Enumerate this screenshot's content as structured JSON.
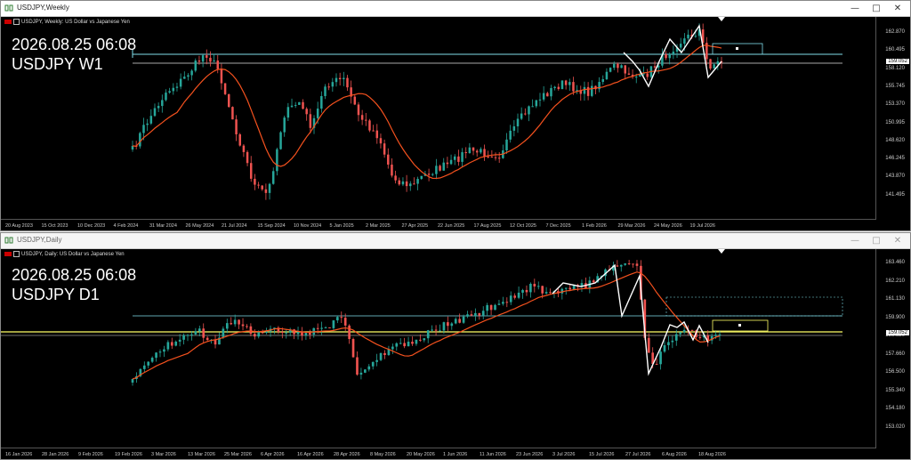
{
  "weekly": {
    "window_title": "USDJPY,Weekly",
    "symbol_desc": "USDJPY, Weekly:  US Dollar vs Japanese Yen",
    "datetime": "2026.08.25 06:08",
    "label": "USDJPY W1",
    "current_price": "159.052",
    "colors": {
      "bull": "#26a69a",
      "bear": "#ef5350",
      "ma": "#f4511e",
      "level": "#80deea"
    },
    "y_ticks": [
      "162.870",
      "160.495",
      "158.120",
      "155.745",
      "153.370",
      "150.995",
      "148.620",
      "146.245",
      "143.870",
      "141.495"
    ],
    "x_ticks": [
      "20 Aug 2023",
      "15 Oct 2023",
      "10 Dec 2023",
      "4 Feb 2024",
      "31 Mar 2024",
      "26 May 2024",
      "21 Jul 2024",
      "15 Sep 2024",
      "10 Nov 2024",
      "5 Jan 2025",
      "2 Mar 2025",
      "27 Apr 2025",
      "22 Jun 2025",
      "17 Aug 2025",
      "12 Oct 2025",
      "7 Dec 2025",
      "1 Feb 2026",
      "29 Mar 2026",
      "24 May 2026",
      "19 Jul 2026"
    ]
  },
  "daily": {
    "window_title": "USDJPY,Daily",
    "symbol_desc": "USDJPY, Daily:  US Dollar vs Japanese Yen",
    "datetime": "2026.08.25 06:08",
    "label": "USDJPY D1",
    "current_price": "159.052",
    "colors": {
      "bull": "#26a69a",
      "bear": "#ef5350",
      "ma": "#f4511e",
      "level": "#80deea",
      "yellow": "#ffff66"
    },
    "y_ticks": [
      "163.460",
      "162.210",
      "161.130",
      "159.900",
      "158.820",
      "157.660",
      "156.500",
      "155.340",
      "154.180",
      "153.020"
    ],
    "x_ticks": [
      "16 Jan 2026",
      "28 Jan 2026",
      "9 Feb 2026",
      "19 Feb 2026",
      "3 Mar 2026",
      "13 Mar 2026",
      "25 Mar 2026",
      "6 Apr 2026",
      "16 Apr 2026",
      "28 Apr 2026",
      "8 May 2026",
      "20 May 2026",
      "1 Jun 2026",
      "11 Jun 2026",
      "23 Jun 2026",
      "3 Jul 2026",
      "15 Jul 2026",
      "27 Jul 2026",
      "6 Aug 2026",
      "18 Aug 2026"
    ]
  },
  "window_buttons": {
    "minimize": "—",
    "maximize": "□",
    "close": "✕"
  }
}
